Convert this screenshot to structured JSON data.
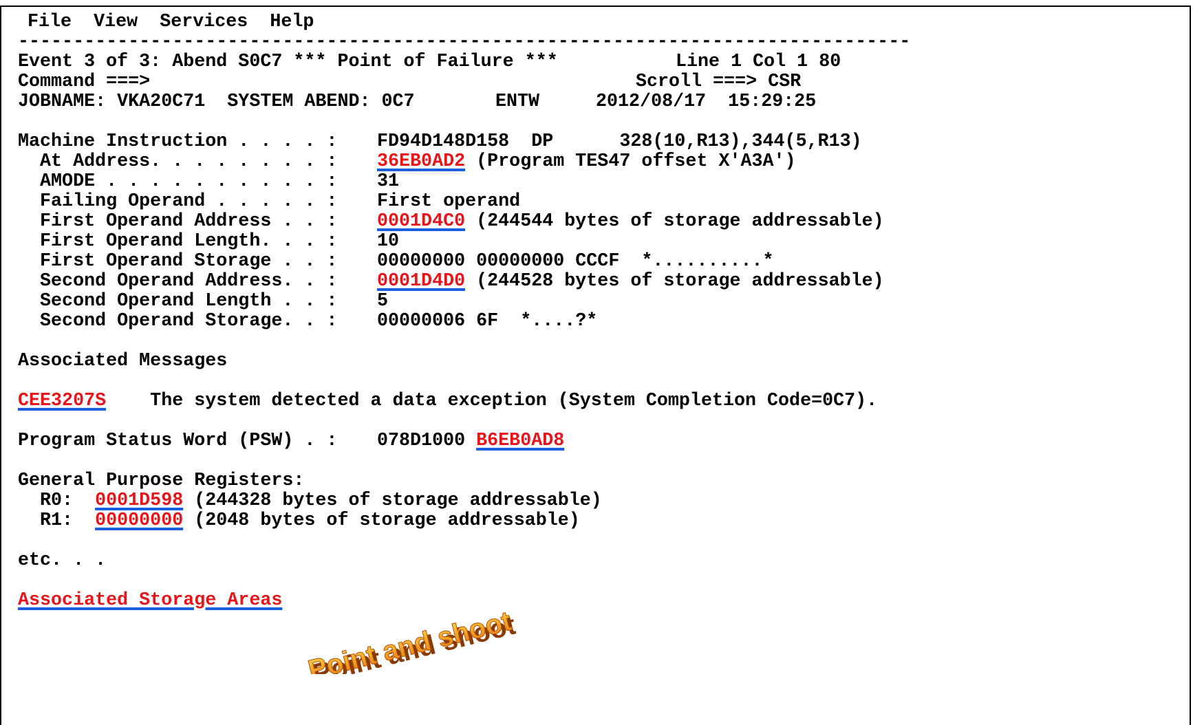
{
  "menu": {
    "file": "File",
    "view": "View",
    "services": "Services",
    "help": "Help"
  },
  "separator": "---------------------------------------------------------------------------------",
  "header": {
    "event_title": "Event 3 of 3: Abend S0C7 *** Point of Failure ***",
    "line_col": "Line 1 Col 1 80",
    "command_label": "Command ===>",
    "command_value": "",
    "scroll_label": "Scroll ===>",
    "scroll_value": "CSR",
    "jobname": "JOBNAME: VKA20C71  SYSTEM ABEND: 0C7",
    "entw": "ENTW",
    "datetime": "2012/08/17  15:29:25"
  },
  "fields": {
    "machine_instruction": {
      "label": "Machine Instruction . . . . :",
      "value": "FD94D148D158  DP      328(10,R13),344(5,R13)"
    },
    "at_address": {
      "label": "  At Address. . . . . . . . :",
      "link": "36EB0AD2",
      "rest": " (Program TES47 offset X'A3A')"
    },
    "amode": {
      "label": "  AMODE . . . . . . . . . . :",
      "value": "31"
    },
    "failing_operand": {
      "label": "  Failing Operand . . . . . :",
      "value": "First operand"
    },
    "first_operand_address": {
      "label": "  First Operand Address . . :",
      "link": "0001D4C0",
      "rest": " (244544 bytes of storage addressable)"
    },
    "first_operand_length": {
      "label": "  First Operand Length. . . :",
      "value": "10"
    },
    "first_operand_storage": {
      "label": "  First Operand Storage . . :",
      "value": "00000000 00000000 CCCF  *..........*"
    },
    "second_operand_address": {
      "label": "  Second Operand Address. . :",
      "link": "0001D4D0",
      "rest": " (244528 bytes of storage addressable)"
    },
    "second_operand_length": {
      "label": "  Second Operand Length . . :",
      "value": "5"
    },
    "second_operand_storage": {
      "label": "  Second Operand Storage. . :",
      "value": "00000006 6F  *....?*"
    }
  },
  "messages": {
    "heading": "Associated Messages",
    "items": [
      {
        "code": "CEE3207S",
        "text": "    The system detected a data exception (System Completion Code=0C7)."
      }
    ]
  },
  "psw": {
    "label": "Program Status Word (PSW) . :",
    "value": "078D1000 ",
    "link": "B6EB0AD8"
  },
  "registers": {
    "heading": "General Purpose Registers:",
    "items": [
      {
        "label": "  R0:  ",
        "link": "0001D598",
        "rest": " (244328 bytes of storage addressable)"
      },
      {
        "label": "  R1:  ",
        "link": "00000000",
        "rest": " (2048 bytes of storage addressable)"
      }
    ]
  },
  "etc": "etc. . .",
  "storage_areas_link": "Associated Storage Areas",
  "callout": "Point and shoot",
  "colors": {
    "link_text": "#e8141c",
    "link_underline": "#1a5fe0",
    "callout_fill_top": "#ffd84a",
    "callout_fill_bottom": "#e8760a",
    "callout_shadow": "#8a3a05"
  }
}
